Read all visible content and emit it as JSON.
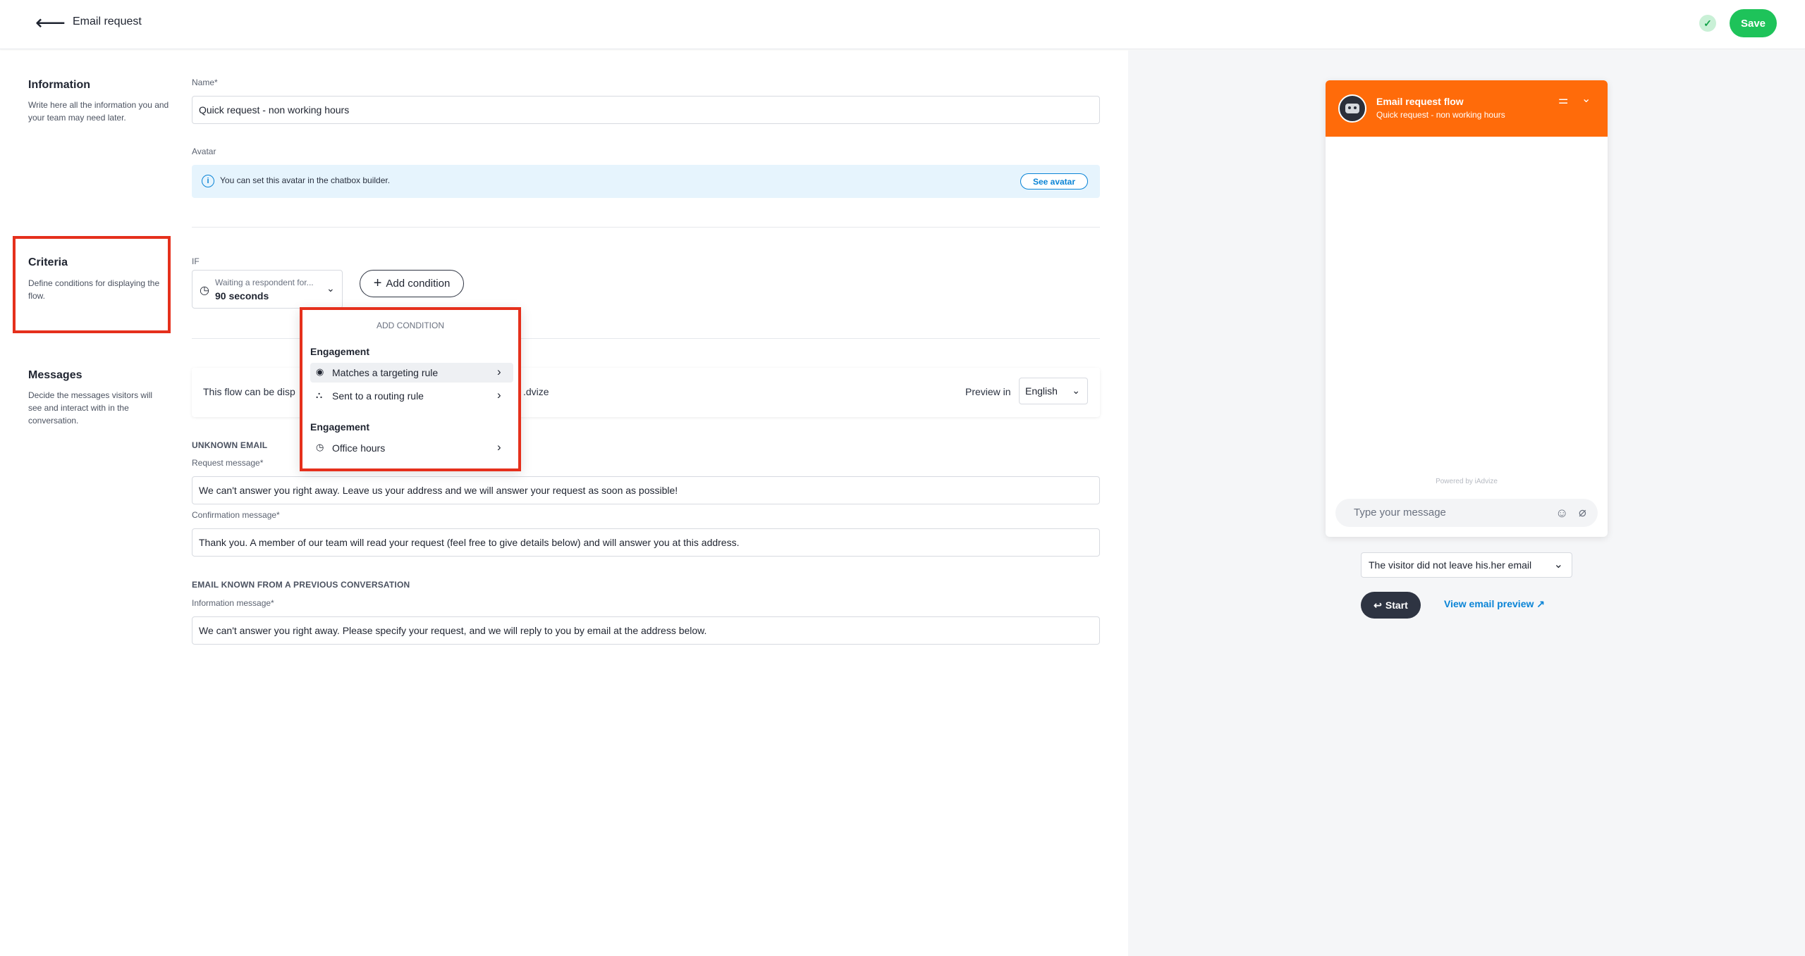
{
  "header": {
    "back_icon": "arrow-left-icon",
    "title": "Email request",
    "saved_icon": "check-icon",
    "save_label": "Save",
    "accent_color": "#1ec35a"
  },
  "information": {
    "title": "Information",
    "description": "Write here all the information you and your team may need later.",
    "name_label": "Name*",
    "name_value": "Quick request - non working hours",
    "avatar_label": "Avatar",
    "avatar_info": "You can set this avatar in the chatbox builder.",
    "see_avatar_label": "See avatar"
  },
  "criteria": {
    "title": "Criteria",
    "description": "Define conditions for displaying the flow.",
    "if_label": "IF",
    "condition_label": "Waiting a respondent for...",
    "condition_value": "90 seconds",
    "add_condition_label": "Add condition"
  },
  "add_condition_menu": {
    "title": "ADD CONDITION",
    "groups": [
      {
        "label": "Engagement",
        "items": [
          {
            "label": "Matches a targeting rule",
            "icon": "target-icon"
          },
          {
            "label": "Sent to a routing rule",
            "icon": "routing-icon"
          }
        ]
      },
      {
        "label": "Engagement",
        "items": [
          {
            "label": "Office hours",
            "icon": "clock-icon"
          }
        ]
      }
    ]
  },
  "messages": {
    "title": "Messages",
    "description": "Decide the messages visitors will see and interact with in the conversation.",
    "bar_text_start": "This flow can be disp",
    "bar_text_end": ".dvize",
    "preview_in_label": "Preview in",
    "language": "English",
    "unknown_email_heading": "UNKNOWN EMAIL",
    "request_label": "Request message*",
    "request_value": "We can't answer you right away. Leave us your address and we will answer your request as soon as possible!",
    "confirmation_label": "Confirmation message*",
    "confirmation_value": "Thank you. A member of our team will read your request (feel free to give details below) and will answer you at this address.",
    "known_email_heading": "EMAIL KNOWN FROM A PREVIOUS CONVERSATION",
    "information_label": "Information message*",
    "information_value": "We can't answer you right away. Please specify your request, and we will reply to you by email at the address below."
  },
  "preview": {
    "chat_title": "Email request flow",
    "chat_subtitle": "Quick request - non working hours",
    "header_color": "#ff6b0a",
    "powered_by": "Powered by iAdvize",
    "input_placeholder": "Type your message",
    "scenario": "The visitor did not leave his.her email",
    "start_label": "Start",
    "email_preview_label": "View email preview"
  }
}
